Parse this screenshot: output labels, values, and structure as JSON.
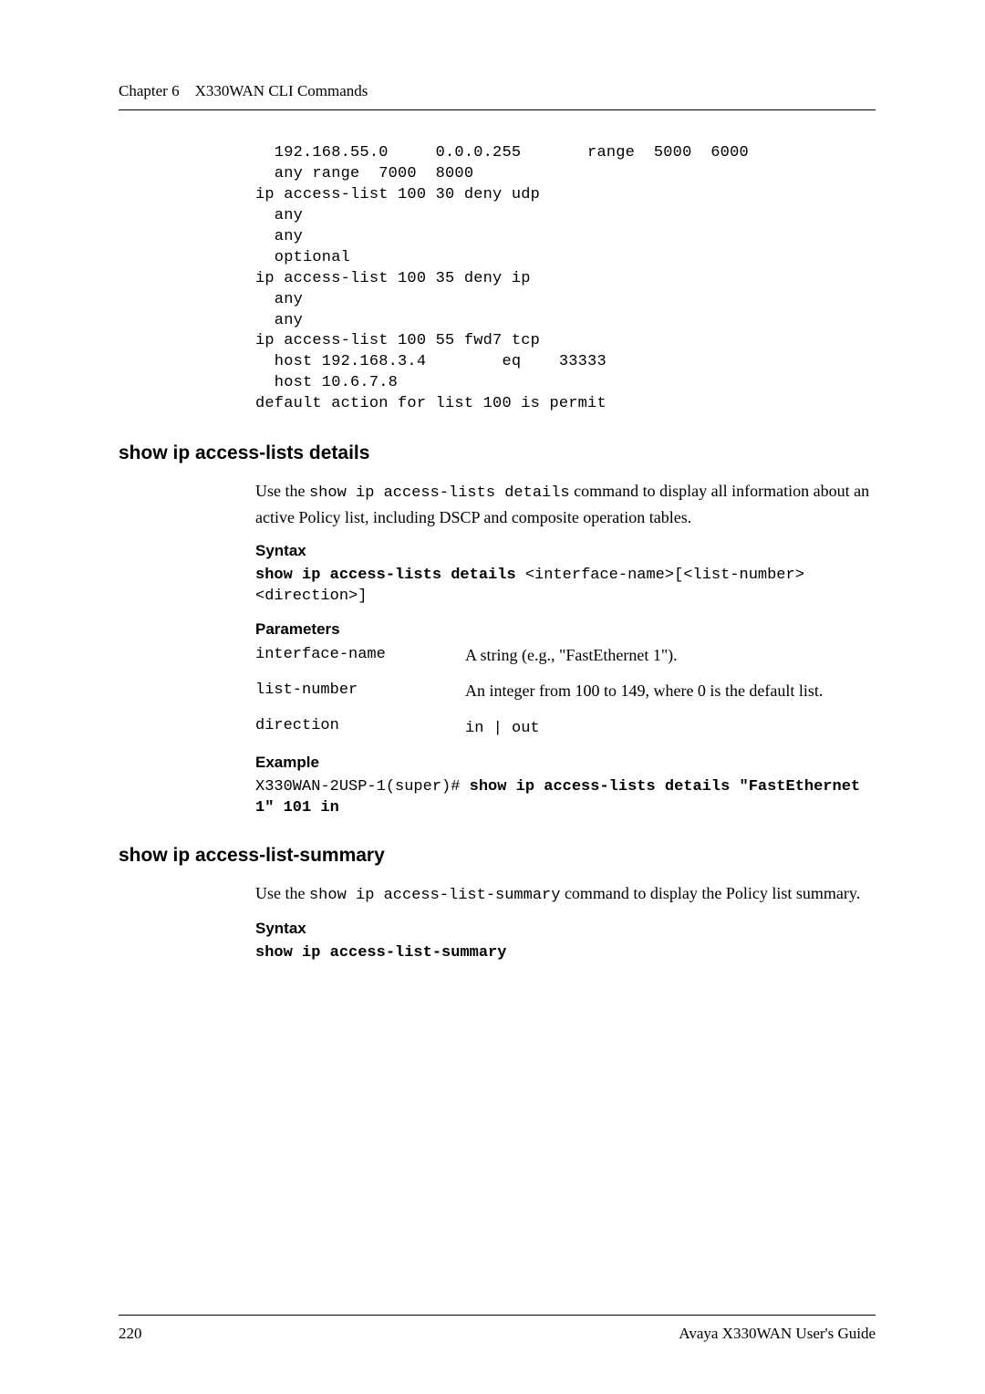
{
  "header": {
    "chapter": "Chapter 6",
    "title": "X330WAN CLI Commands"
  },
  "code_block": "  192.168.55.0     0.0.0.255       range  5000  6000\n  any range  7000  8000\nip access-list 100 30 deny udp\n  any\n  any\n  optional\nip access-list 100 35 deny ip\n  any\n  any\nip access-list 100 55 fwd7 tcp\n  host 192.168.3.4        eq    33333\n  host 10.6.7.8\ndefault action for list 100 is permit",
  "section1": {
    "title": "show ip access-lists details",
    "intro_pre": "Use the ",
    "intro_cmd": "show ip access-lists details",
    "intro_post": " command to display all information about an active Policy list, including DSCP and composite operation tables.",
    "syntax_label": "Syntax",
    "syntax_cmd": "show ip access-lists details",
    "syntax_args": " <interface-name>[<list-number><direction>]",
    "parameters_label": "Parameters",
    "params": [
      {
        "key": "interface-name",
        "val": "A string (e.g., \"FastEthernet 1\")."
      },
      {
        "key": "list-number",
        "val": "An integer from 100 to 149, where 0 is the default list."
      },
      {
        "key": "direction",
        "val_mono": "in | out"
      }
    ],
    "example_label": "Example",
    "example_prefix": "X330WAN-2USP-1(super)# ",
    "example_cmd": "show ip access-lists details \"FastEthernet 1\" 101 in"
  },
  "section2": {
    "title": "show ip access-list-summary",
    "intro_pre": "Use the ",
    "intro_cmd": "show ip access-list-summary",
    "intro_post": " command to display the Policy list summary.",
    "syntax_label": "Syntax",
    "syntax_cmd": "show ip access-list-summary"
  },
  "footer": {
    "page": "220",
    "guide": "Avaya X330WAN User's Guide"
  }
}
